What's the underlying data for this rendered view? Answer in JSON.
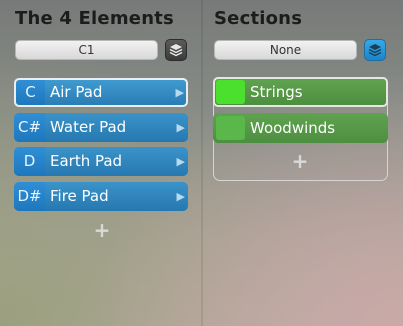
{
  "left_panel": {
    "title": "The 4 Elements",
    "selector_value": "C1",
    "stack_icon": "stack-layers-icon",
    "pads": [
      {
        "note": "C",
        "label": "Air Pad",
        "selected": true
      },
      {
        "note": "C#",
        "label": "Water Pad",
        "selected": false
      },
      {
        "note": "D",
        "label": "Earth Pad",
        "selected": false
      },
      {
        "note": "D#",
        "label": "Fire Pad",
        "selected": false
      }
    ],
    "add_label": "+"
  },
  "right_panel": {
    "title": "Sections",
    "selector_value": "None",
    "stack_icon": "stack-layers-icon",
    "sections": [
      {
        "label": "Strings",
        "swatch_color": "#4ce02e",
        "selected": true
      },
      {
        "label": "Woodwinds",
        "swatch_color": "#5ab84a",
        "selected": false
      }
    ],
    "add_label": "+"
  },
  "colors": {
    "pad_blue": "#2a80b8",
    "note_blue": "#2186cc",
    "section_green": "#559a46",
    "accent_blue": "#2398da"
  }
}
